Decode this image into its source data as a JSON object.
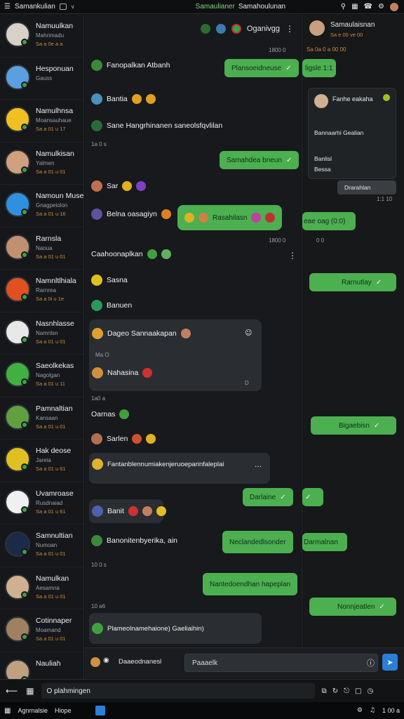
{
  "topbar": {
    "app_title": "Samankulian",
    "tab_active": "Samaulianer",
    "tab_other": "Samahoulunan"
  },
  "sidebar": {
    "contacts": [
      {
        "name": "Namuulkan",
        "sub": "Mahrimadu",
        "meta": "Sa a 0e a a",
        "color": "#d9d0c8"
      },
      {
        "name": "Hesponuan",
        "sub": "Gauss",
        "meta": "",
        "color": "#5aa0e0"
      },
      {
        "name": "Namulhnsa",
        "sub": "Moansauhaue",
        "meta": "Sa a 01 u 17",
        "color": "#f0c020"
      },
      {
        "name": "Namulkisan",
        "sub": "Yalmen",
        "meta": "Sa a 01 u 01",
        "color": "#d0a080"
      },
      {
        "name": "Namoun Muse",
        "sub": "Gnagpeiolon",
        "meta": "Sa a 01 u 16",
        "color": "#3090e0"
      },
      {
        "name": "Rarnsla",
        "sub": "Naoua",
        "meta": "Sa a 01 u 01",
        "color": "#c09070"
      },
      {
        "name": "Namnltlhiala",
        "sub": "Rarnrea",
        "meta": "Sa a 0i u 1e",
        "color": "#e05020"
      },
      {
        "name": "Nasnhlasse",
        "sub": "Namnlsn",
        "meta": "Sa a 01 u 01",
        "color": "#e8e8e8"
      },
      {
        "name": "Saeolkekas",
        "sub": "Nagolgan",
        "meta": "Sa a 01 u 11",
        "color": "#40b040"
      },
      {
        "name": "Pamnaltian",
        "sub": "Kansaan",
        "meta": "Sa a 01 u 01",
        "color": "#60a040"
      },
      {
        "name": "Hak deose",
        "sub": "Jareia",
        "meta": "Sa a 01 u 61",
        "color": "#e0c020"
      },
      {
        "name": "Uvamroase",
        "sub": "Rusdnaiad",
        "meta": "Sa a 01 u 61",
        "color": "#f0f0f0"
      },
      {
        "name": "Samnultian",
        "sub": "Numoan",
        "meta": "Sa a 01 u 01",
        "color": "#1a2a4a"
      },
      {
        "name": "Namulkan",
        "sub": "Aesamna",
        "meta": "Sa a 01 u 01",
        "color": "#d0b090"
      },
      {
        "name": "Cotinnaper",
        "sub": "Moamand",
        "meta": "Sa a 01 u 01",
        "color": "#a08060"
      },
      {
        "name": "Nauliah",
        "sub": "",
        "meta": "",
        "color": "#c0a080"
      }
    ]
  },
  "chat": {
    "header": {
      "status": "Oganivgg"
    },
    "messages": {
      "ts1": "1800 0",
      "in1": "Fanopalkan Atbanh",
      "out1": "Plansoeidneuse",
      "in2": "Bantia",
      "in3": "Sane Hangrhinanen saneolsfqvlilan",
      "ts2": "1a 0 s",
      "out2": "Samahdea bneun",
      "in4": "Sar",
      "in5": "Belna oasagiyn",
      "out3": "Rasahilasn",
      "ts3": "1800 0",
      "section": "Caahoonaplkan",
      "in6": "Sasna",
      "in7": "Banuen",
      "card1_title": "Dageo Sannaakapan",
      "card1_sub": "Ma O",
      "card1_line": "Nahasina",
      "card1_time": "D",
      "ts4": "1a0 a",
      "in8": "Oarnas",
      "in9": "Sarlen",
      "card2_line": "Fantanblennumiakenjeruoeparinfaleplai",
      "out4": "Darlaine",
      "in10": "Banit",
      "in11": "Banonitenbyerika, ain",
      "out5": "Neclandedlsonder",
      "ts5": "10 0 s",
      "ts6": "10 a6",
      "out6": "Nantedoendhan hapeplan",
      "out7": "Nonnjeatlen",
      "card3_line": "Plameolnamehaione) Gaeliaihin)",
      "out_right1": "Bigaebisn",
      "out_right2": "Darmalnan"
    }
  },
  "rpanel": {
    "title": "Samaulaisnan",
    "sub": "Sa e 00 ve 00",
    "ts": "Sa 0a 0 a 00 00",
    "top_bubble": "ligsle 1:1",
    "card_title": "Fanhe eakaha",
    "card_line1": "Bannaarhi Gealian",
    "card_line2": "Banlisl",
    "card_line3": "Bessa",
    "chip": "Drarahlan",
    "ts2": "1:1 10",
    "bubble2": "eae oag (0:0)",
    "bubble3": "Rarnutlay",
    "ts3": "0 0"
  },
  "composer": {
    "label": "Daaeodnanesl",
    "placeholder": "Paaaelk"
  },
  "bottombar": {
    "search_text": "O plahmingen"
  },
  "taskbar": {
    "item1": "Agnrnalsie",
    "item2": "Hiope",
    "clock": "1 00 a"
  }
}
